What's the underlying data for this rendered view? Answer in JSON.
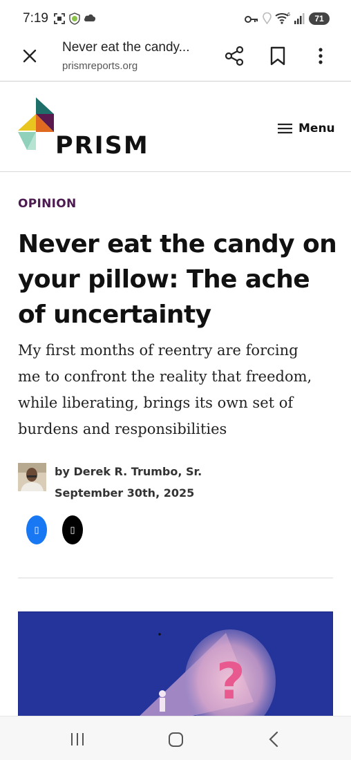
{
  "status_bar": {
    "time": "7:19",
    "battery": "71",
    "icons": [
      "screenshot-icon",
      "shield-icon",
      "cloud-icon",
      "key-icon",
      "location-icon",
      "wifi-icon",
      "signal-icon",
      "battery-icon"
    ],
    "wifi_label": "6"
  },
  "browser": {
    "title": "Never eat the candy...",
    "url": "prismreports.org",
    "actions": [
      "close-icon",
      "share-icon",
      "bookmark-icon",
      "more-icon"
    ]
  },
  "site": {
    "logo_text": "PRISM",
    "menu_label": "Menu",
    "brand_colors": [
      "#1e6f6a",
      "#5a1a4f",
      "#e8c51f",
      "#e06a1f",
      "#8fd1bb"
    ]
  },
  "article": {
    "kicker": "OPINION",
    "headline_lines": [
      "Never eat the candy on",
      "your pillow: The ache",
      "of uncertainty"
    ],
    "dek_lines": [
      "My first months of reentry are forcing",
      "me to confront the reality that freedom,",
      "while liberating, brings its own set of",
      "burdens and responsibilities"
    ],
    "byline": "by Derek R. Trumbo, Sr.",
    "date": "September 30th, 2025",
    "share": {
      "facebook_glyph": "▯",
      "x_glyph": "▯",
      "facebook_color": "#1877f2",
      "x_color": "#000000"
    },
    "accent_color": "#4b1a4f"
  },
  "nav": {
    "buttons": [
      "recents-icon",
      "home-icon",
      "back-icon"
    ]
  }
}
